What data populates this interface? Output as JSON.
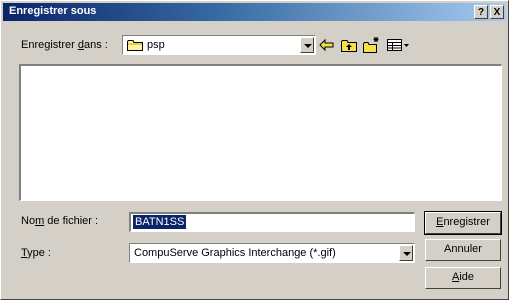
{
  "dialog": {
    "title": "Enregistrer sous",
    "help_button": "?",
    "close_button": "X"
  },
  "save_in": {
    "label_pre": "Enregistrer ",
    "label_key": "d",
    "label_post": "ans :",
    "value": "psp"
  },
  "toolbar": {
    "icons": [
      "back-arrow-icon",
      "up-folder-icon",
      "new-folder-icon",
      "view-menu-icon"
    ]
  },
  "file_list": {
    "items": []
  },
  "filename": {
    "label_pre": "No",
    "label_key": "m",
    "label_post": " de fichier :",
    "value": "BATN1SS"
  },
  "filetype": {
    "label_key": "T",
    "label_post": "ype :",
    "value": "CompuServe Graphics Interchange (*.gif)"
  },
  "buttons": {
    "save_key": "E",
    "save_rest": "nregistrer",
    "cancel": "Annuler",
    "help_key": "A",
    "help_rest": "ide"
  },
  "colors": {
    "title_start": "#0a246a",
    "title_end": "#a6caf0",
    "face": "#d4d0c8",
    "selection": "#0a246a"
  }
}
